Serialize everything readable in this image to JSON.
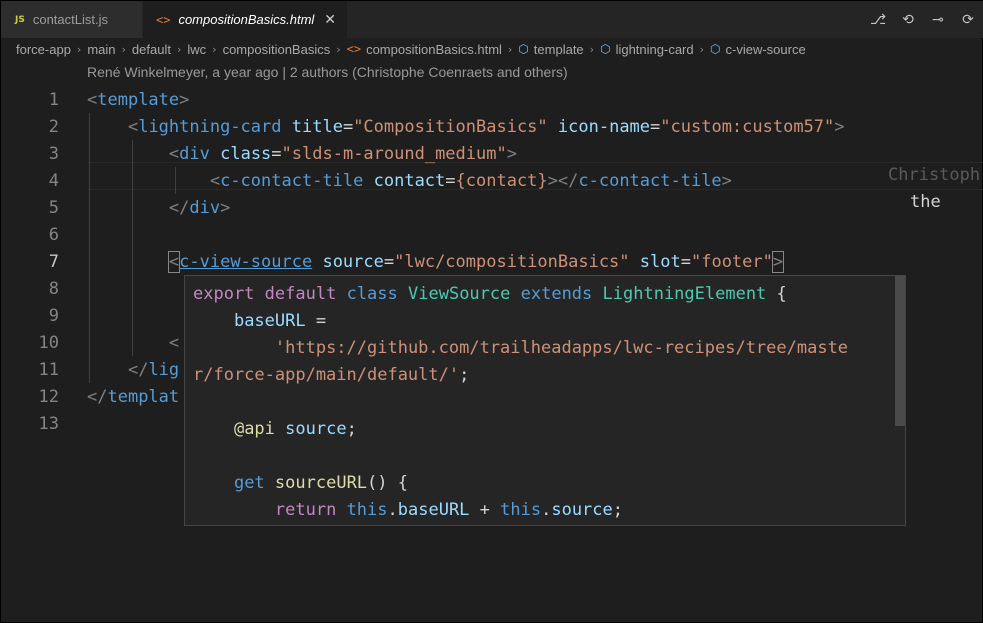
{
  "tabs": [
    {
      "badge": "JS",
      "label": "contactList.js"
    },
    {
      "icon": "<>",
      "label": "compositionBasics.html",
      "close": "✕"
    }
  ],
  "breadcrumb": [
    "force-app",
    "main",
    "default",
    "lwc",
    "compositionBasics",
    "compositionBasics.html",
    "template",
    "lightning-card",
    "c-view-source"
  ],
  "codelens": "René Winkelmeyer, a year ago | 2 authors (Christophe Coenraets and others)",
  "line_numbers": [
    "1",
    "2",
    "3",
    "4",
    "5",
    "6",
    "7",
    "8",
    "9",
    "10",
    "11",
    "12",
    "13"
  ],
  "active_line": "7",
  "code": {
    "l1": {
      "lt": "<",
      "tag": "template",
      "gt": ">"
    },
    "l2": {
      "lt": "<",
      "tag": "lightning-card",
      "attr1": "title",
      "eq": "=",
      "val1": "\"CompositionBasics\"",
      "attr2": "icon-name",
      "val2": "\"custom:custom57\"",
      "gt": ">"
    },
    "l3": {
      "lt": "<",
      "tag": "div",
      "attr1": "class",
      "eq": "=",
      "val1": "\"slds-m-around_medium\"",
      "gt": ">"
    },
    "l4": {
      "lt": "<",
      "tag": "c-contact-tile",
      "attr1": "contact",
      "eq": "=",
      "expr": "{contact}",
      "close": "></",
      "endtag": "c-contact-tile",
      "gt": ">"
    },
    "l5": {
      "lt": "</",
      "tag": "div",
      "gt": ">"
    },
    "l7": {
      "lt": "<",
      "tag": "c-view-source",
      "attr1": "source",
      "eq": "=",
      "val1": "\"lwc/compositionBasics\"",
      "attr2": "slot",
      "val2": "\"footer\"",
      "gt": ">"
    },
    "l10": {
      "lt": "<"
    },
    "l11": {
      "lt": "</",
      "tag": "lig"
    },
    "l12": {
      "lt": "</",
      "tag": "templat"
    },
    "l8_tail": "the"
  },
  "inline_blame": "Christoph",
  "hover": {
    "h1": {
      "kw1": "export",
      "kw2": "default",
      "kw3": "class",
      "cls": "ViewSource",
      "kw4": "extends",
      "base": "LightningElement",
      "brace": "{"
    },
    "h2": {
      "prop": "baseURL",
      "eq": "="
    },
    "h3": {
      "str": "'https://github.com/trailheadapps/lwc-recipes/tree/maste"
    },
    "h4": {
      "str": "r/force-app/main/default/'",
      "semi": ";"
    },
    "h6": {
      "dec": "@api",
      "prop": "source",
      "semi": ";"
    },
    "h8": {
      "kw": "get",
      "fn": "sourceURL",
      "rest": "() {"
    },
    "h9": {
      "kw": "return",
      "this1": "this",
      "dot1": ".",
      "p1": "baseURL",
      "plus": " + ",
      "this2": "this",
      "dot2": ".",
      "p2": "source",
      "semi": ";"
    }
  },
  "icons": {
    "actions": [
      "source-control-icon",
      "go-back-icon",
      "git-commit-icon",
      "go-forward-icon"
    ]
  }
}
